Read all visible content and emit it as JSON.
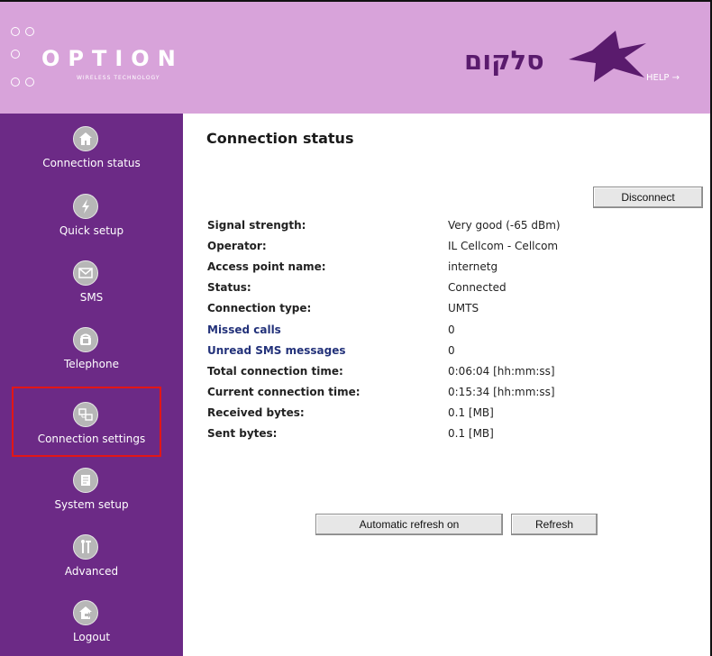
{
  "header": {
    "logo_text": "OPTION",
    "logo_subtitle": "WIRELESS TECHNOLOGY",
    "brand_text": "סלקום",
    "help_label": "HELP →"
  },
  "nav": {
    "items": [
      {
        "label": "Connection status",
        "icon": "home-icon"
      },
      {
        "label": "Quick setup",
        "icon": "lightning-icon"
      },
      {
        "label": "SMS",
        "icon": "envelope-icon"
      },
      {
        "label": "Telephone",
        "icon": "telephone-icon"
      },
      {
        "label": "Connection settings",
        "icon": "network-icon"
      },
      {
        "label": "System setup",
        "icon": "document-icon"
      },
      {
        "label": "Advanced",
        "icon": "tools-icon"
      },
      {
        "label": "Logout",
        "icon": "logout-icon"
      }
    ],
    "selected_label": "Connection settings"
  },
  "main": {
    "title": "Connection status",
    "disconnect_label": "Disconnect",
    "rows": [
      {
        "label": "Signal strength:",
        "value": "Very good (-65 dBm)",
        "link": false
      },
      {
        "label": "Operator:",
        "value": "IL Cellcom - Cellcom",
        "link": false
      },
      {
        "label": "Access point name:",
        "value": "internetg",
        "link": false
      },
      {
        "label": "Status:",
        "value": "Connected",
        "link": false
      },
      {
        "label": "Connection type:",
        "value": "UMTS",
        "link": false
      },
      {
        "label": "Missed calls",
        "value": "0",
        "link": true
      },
      {
        "label": "Unread SMS messages",
        "value": "0",
        "link": true
      },
      {
        "label": "Total connection time:",
        "value": "0:06:04 [hh:mm:ss]",
        "link": false
      },
      {
        "label": "Current connection time:",
        "value": "0:15:34 [hh:mm:ss]",
        "link": false
      },
      {
        "label": "Received bytes:",
        "value": "0.1 [MB]",
        "link": false
      },
      {
        "label": "Sent bytes:",
        "value": "0.1 [MB]",
        "link": false
      }
    ],
    "auto_refresh_label": "Automatic refresh on",
    "refresh_label": "Refresh"
  },
  "colors": {
    "header_bg": "#d8a3da",
    "sidebar_bg": "#6c2a86",
    "brand_purple": "#5a1b6d",
    "highlight": "#e31616",
    "link": "#23327a"
  }
}
